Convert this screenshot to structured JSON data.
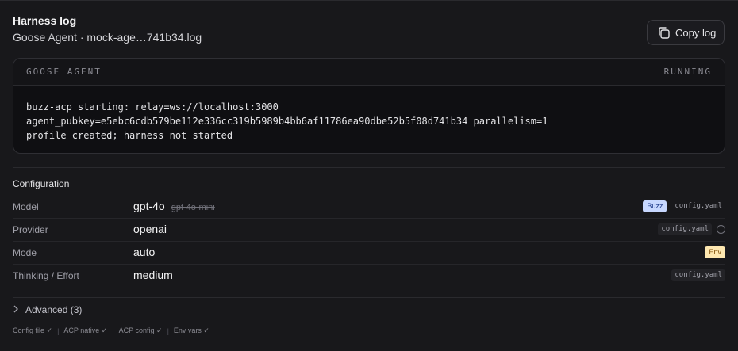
{
  "header": {
    "title": "Harness log",
    "subtitle": "Goose Agent · mock-age…741b34.log",
    "copy_label": "Copy log"
  },
  "log": {
    "agent_name": "GOOSE AGENT",
    "status": "RUNNING",
    "lines": [
      "buzz-acp starting: relay=ws://localhost:3000",
      "agent_pubkey=e5ebc6cdb579be112e336cc319b5989b4bb6af11786ea90dbe52b5f08d741b34 parallelism=1",
      "profile created; harness not started"
    ]
  },
  "configuration": {
    "title": "Configuration",
    "rows": [
      {
        "label": "Model",
        "value": "gpt-4o",
        "old_value": "gpt-4o-mini",
        "tags": [
          "Buzz",
          "config.yaml"
        ]
      },
      {
        "label": "Provider",
        "value": "openai",
        "tags": [
          "config.yaml"
        ]
      },
      {
        "label": "Mode",
        "value": "auto",
        "tags": [
          "Env"
        ]
      },
      {
        "label": "Thinking / Effort",
        "value": "medium",
        "tags": [
          "config.yaml"
        ]
      }
    ]
  },
  "advanced_label": "Advanced (3)",
  "footer": [
    "Config file ✓",
    "|",
    "ACP native ✓",
    "|",
    "ACP config ✓",
    "|",
    "Env vars ✓"
  ],
  "colors": {
    "background": "#18181b",
    "buzz_tag": "#c7d7fe",
    "env_tag": "#fde7b0"
  },
  "icons": {
    "copy": "copy-icon",
    "info": "info-icon",
    "chevron": "chevron-right-icon"
  }
}
